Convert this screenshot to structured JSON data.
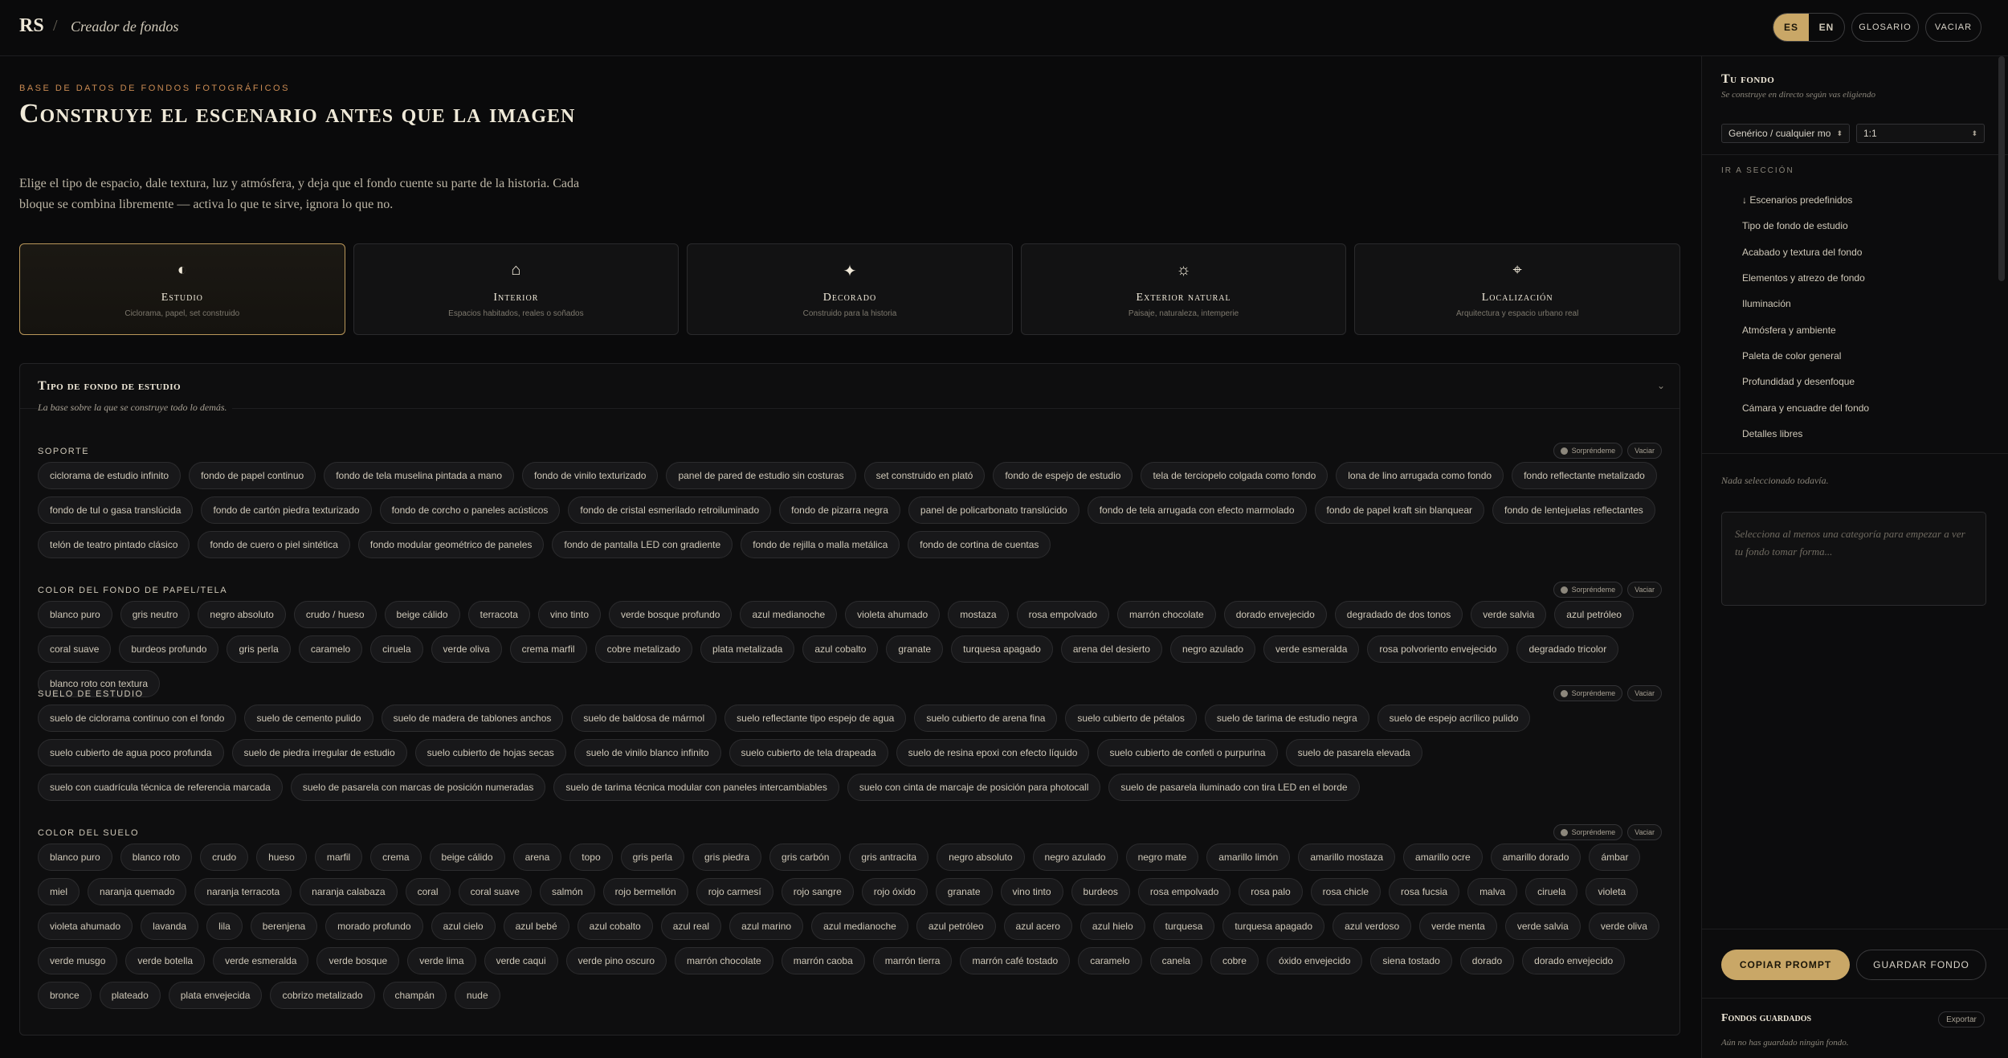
{
  "header": {
    "logo": "RS",
    "separator": "/",
    "app_title": "Creador de fondos",
    "lang_es": "ES",
    "lang_en": "EN",
    "glosario": "GLOSARIO",
    "vaciar": "VACIAR"
  },
  "hero": {
    "eyebrow": "BASE DE DATOS DE FONDOS FOTOGRÁFICOS",
    "headline": "Construye el escenario antes que la imagen",
    "intro": "Elige el tipo de espacio, dale textura, luz y atmósfera, y deja que el fondo cuente su parte de la historia. Cada bloque se combina libremente — activa lo que te sirve, ignora lo que no."
  },
  "categories": [
    {
      "icon": "◐",
      "title": "Estudio",
      "subtitle": "Ciclorama, papel, set construido",
      "active": true
    },
    {
      "icon": "⌂",
      "title": "Interior",
      "subtitle": "Espacios habitados, reales o soñados",
      "active": false
    },
    {
      "icon": "✦",
      "title": "Decorado",
      "subtitle": "Construido para la historia",
      "active": false
    },
    {
      "icon": "☼",
      "title": "Exterior natural",
      "subtitle": "Paisaje, naturaleza, intemperie",
      "active": false
    },
    {
      "icon": "⌖",
      "title": "Localización",
      "subtitle": "Arquitectura y espacio urbano real",
      "active": false
    }
  ],
  "panel": {
    "title": "Tipo de fondo de estudio",
    "description": "La base sobre la que se construye todo lo demás.",
    "chevron": "⌄",
    "tool_surprise": "Sorpréndeme",
    "tool_clear": "Vaciar",
    "groups": [
      {
        "label": "SOPORTE",
        "chips": [
          "ciclorama de estudio infinito",
          "fondo de papel continuo",
          "fondo de tela muselina pintada a mano",
          "fondo de vinilo texturizado",
          "panel de pared de estudio sin costuras",
          "set construido en plató",
          "fondo de espejo de estudio",
          "tela de terciopelo colgada como fondo",
          "lona de lino arrugada como fondo",
          "fondo reflectante metalizado",
          "fondo de tul o gasa translúcida",
          "fondo de cartón piedra texturizado",
          "fondo de corcho o paneles acústicos",
          "fondo de cristal esmerilado retroiluminado",
          "fondo de pizarra negra",
          "panel de policarbonato translúcido",
          "fondo de tela arrugada con efecto marmolado",
          "fondo de papel kraft sin blanquear",
          "fondo de lentejuelas reflectantes",
          "telón de teatro pintado clásico",
          "fondo de cuero o piel sintética",
          "fondo modular geométrico de paneles",
          "fondo de pantalla LED con gradiente",
          "fondo de rejilla o malla metálica",
          "fondo de cortina de cuentas"
        ]
      },
      {
        "label": "COLOR DEL FONDO DE PAPEL/TELA",
        "chips": [
          "blanco puro",
          "gris neutro",
          "negro absoluto",
          "crudo / hueso",
          "beige cálido",
          "terracota",
          "vino tinto",
          "verde bosque profundo",
          "azul medianoche",
          "violeta ahumado",
          "mostaza",
          "rosa empolvado",
          "marrón chocolate",
          "dorado envejecido",
          "degradado de dos tonos",
          "verde salvia",
          "azul petróleo",
          "coral suave",
          "burdeos profundo",
          "gris perla",
          "caramelo",
          "ciruela",
          "verde oliva",
          "crema marfil",
          "cobre metalizado",
          "plata metalizada",
          "azul cobalto",
          "granate",
          "turquesa apagado",
          "arena del desierto",
          "negro azulado",
          "verde esmeralda",
          "rosa polvoriento envejecido",
          "degradado tricolor",
          "blanco roto con textura"
        ]
      },
      {
        "label": "SUELO DE ESTUDIO",
        "chips": [
          "suelo de ciclorama continuo con el fondo",
          "suelo de cemento pulido",
          "suelo de madera de tablones anchos",
          "suelo de baldosa de mármol",
          "suelo reflectante tipo espejo de agua",
          "suelo cubierto de arena fina",
          "suelo cubierto de pétalos",
          "suelo de tarima de estudio negra",
          "suelo de espejo acrílico pulido",
          "suelo cubierto de agua poco profunda",
          "suelo de piedra irregular de estudio",
          "suelo cubierto de hojas secas",
          "suelo de vinilo blanco infinito",
          "suelo cubierto de tela drapeada",
          "suelo de resina epoxi con efecto líquido",
          "suelo cubierto de confeti o purpurina",
          "suelo de pasarela elevada",
          "suelo con cuadrícula técnica de referencia marcada",
          "suelo de pasarela con marcas de posición numeradas",
          "suelo de tarima técnica modular con paneles intercambiables",
          "suelo con cinta de marcaje de posición para photocall",
          "suelo de pasarela iluminado con tira LED en el borde"
        ]
      },
      {
        "label": "COLOR DEL SUELO",
        "chips": [
          "blanco puro",
          "blanco roto",
          "crudo",
          "hueso",
          "marfil",
          "crema",
          "beige cálido",
          "arena",
          "topo",
          "gris perla",
          "gris piedra",
          "gris carbón",
          "gris antracita",
          "negro absoluto",
          "negro azulado",
          "negro mate",
          "amarillo limón",
          "amarillo mostaza",
          "amarillo ocre",
          "amarillo dorado",
          "ámbar",
          "miel",
          "naranja quemado",
          "naranja terracota",
          "naranja calabaza",
          "coral",
          "coral suave",
          "salmón",
          "rojo bermellón",
          "rojo carmesí",
          "rojo sangre",
          "rojo óxido",
          "granate",
          "vino tinto",
          "burdeos",
          "rosa empolvado",
          "rosa palo",
          "rosa chicle",
          "rosa fucsia",
          "malva",
          "ciruela",
          "violeta",
          "violeta ahumado",
          "lavanda",
          "lila",
          "berenjena",
          "morado profundo",
          "azul cielo",
          "azul bebé",
          "azul cobalto",
          "azul real",
          "azul marino",
          "azul medianoche",
          "azul petróleo",
          "azul acero",
          "azul hielo",
          "turquesa",
          "turquesa apagado",
          "azul verdoso",
          "verde menta",
          "verde salvia",
          "verde oliva",
          "verde musgo",
          "verde botella",
          "verde esmeralda",
          "verde bosque",
          "verde lima",
          "verde caqui",
          "verde pino oscuro",
          "marrón chocolate",
          "marrón caoba",
          "marrón tierra",
          "marrón café tostado",
          "caramelo",
          "canela",
          "cobre",
          "óxido envejecido",
          "siena tostado",
          "dorado",
          "dorado envejecido",
          "bronce",
          "plateado",
          "plata envejecida",
          "cobrizo metalizado",
          "champán",
          "nude"
        ]
      }
    ]
  },
  "sidebar": {
    "title": "Tu fondo",
    "subtitle": "Se construye en directo según vas eligiendo",
    "model_select": "Genérico / cualquier mo",
    "ratio_select": "1:1",
    "goto_label": "IR A SECCIÓN",
    "nav": [
      "↓ Escenarios predefinidos",
      "Tipo de fondo de estudio",
      "Acabado y textura del fondo",
      "Elementos y atrezo de fondo",
      "Iluminación",
      "Atmósfera y ambiente",
      "Paleta de color general",
      "Profundidad y desenfoque",
      "Cámara y encuadre del fondo",
      "Detalles libres"
    ],
    "empty": "Nada seleccionado todavía.",
    "preview_placeholder": "Selecciona al menos una categoría para empezar a ver tu fondo tomar forma...",
    "copy_button": "COPIAR PROMPT",
    "save_button": "GUARDAR FONDO",
    "saved_title": "Fondos guardados",
    "export_button": "Exportar",
    "saved_empty": "Aún no has guardado ningún fondo."
  },
  "colors": {
    "accent": "#c9a767",
    "eyebrow": "#c98a52",
    "background": "#0a0a0b"
  }
}
